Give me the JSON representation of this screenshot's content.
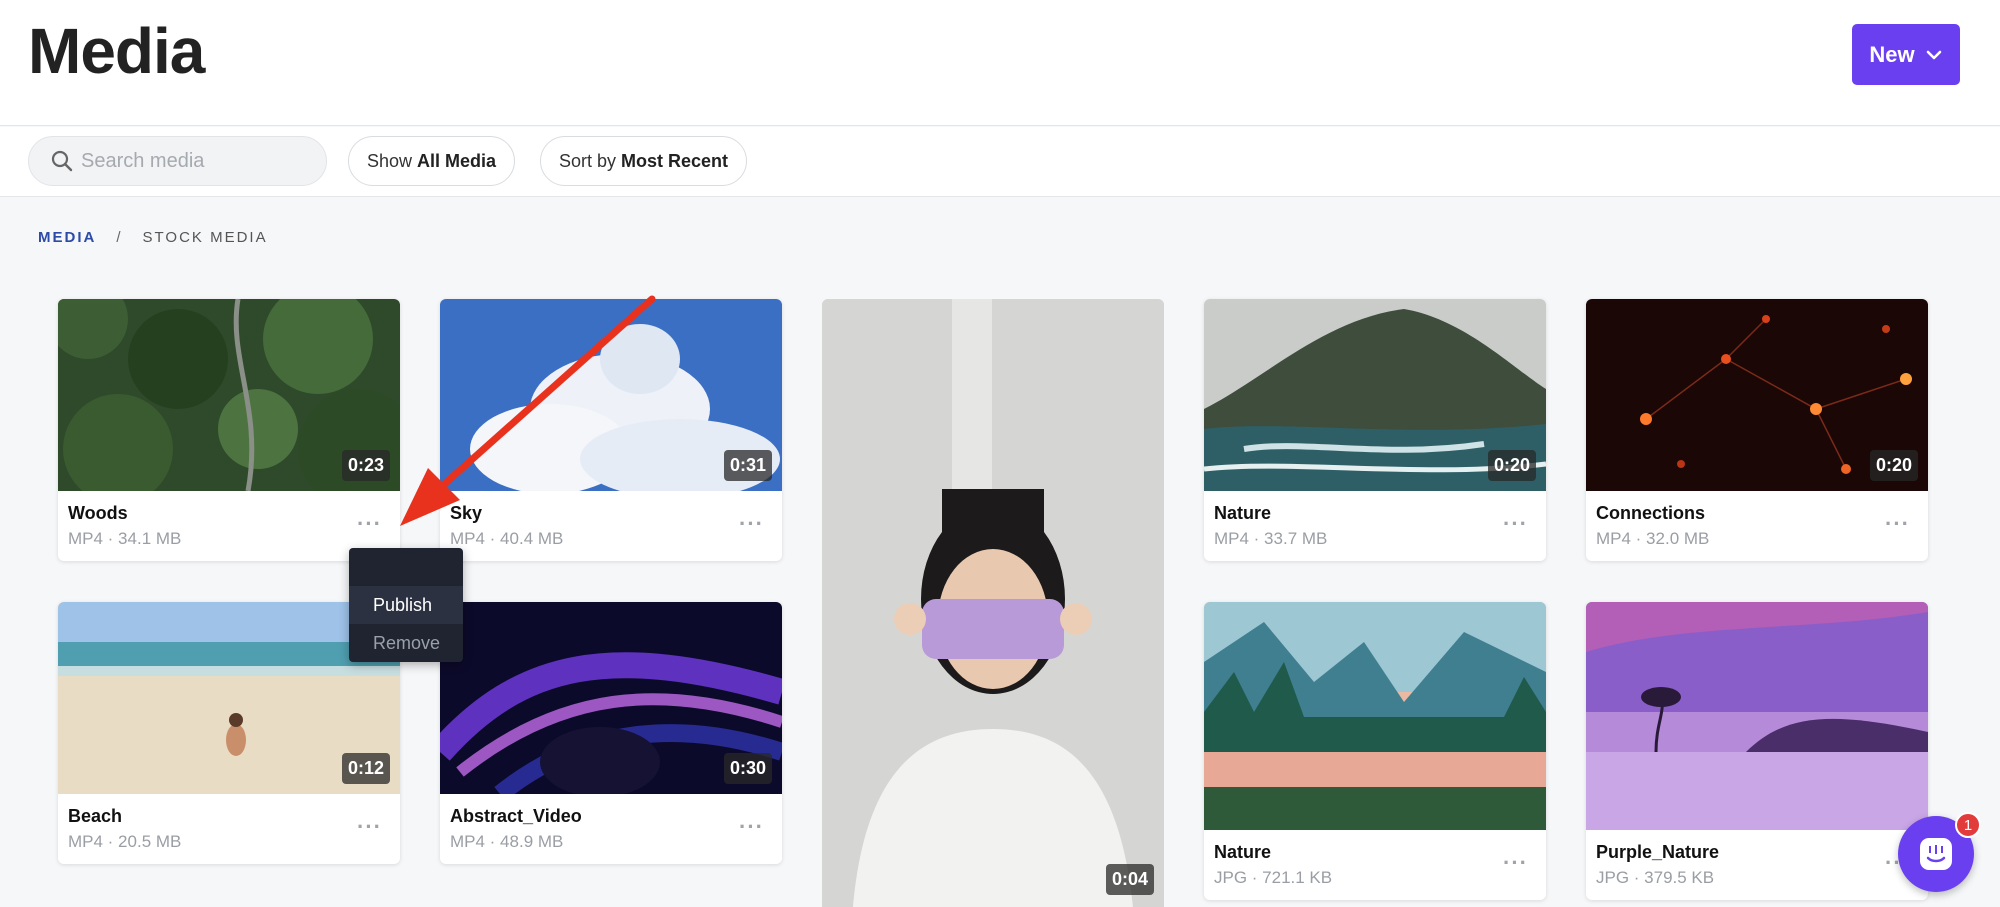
{
  "header": {
    "title": "Media",
    "new_label": "New"
  },
  "toolbar": {
    "search_placeholder": "Search media",
    "show_prefix": "Show",
    "show_value": "All Media",
    "sort_prefix": "Sort by",
    "sort_value": "Most Recent"
  },
  "breadcrumb": {
    "root": "MEDIA",
    "separator": "/",
    "current": "STOCK MEDIA"
  },
  "cards": [
    {
      "name": "Woods",
      "info": "MP4 · 34.1 MB",
      "duration": "0:23"
    },
    {
      "name": "Sky",
      "info": "MP4 · 40.4 MB",
      "duration": "0:31"
    },
    {
      "name": "Nature",
      "info": "MP4 · 33.7 MB",
      "duration": "0:20"
    },
    {
      "name": "Connections",
      "info": "MP4 · 32.0 MB",
      "duration": "0:20"
    },
    {
      "name": "Beach",
      "info": "MP4 · 20.5 MB",
      "duration": "0:12"
    },
    {
      "name": "Abstract_Video",
      "info": "MP4 · 48.9 MB",
      "duration": "0:30"
    },
    {
      "name": "Nature",
      "info": "JPG · 721.1 KB"
    },
    {
      "name": "Purple_Nature",
      "info": "JPG · 379.5 KB"
    }
  ],
  "tall_card": {
    "duration": "0:04"
  },
  "context_menu": {
    "publish": "Publish",
    "remove": "Remove"
  },
  "chat": {
    "badge_count": "1"
  },
  "colors": {
    "accent": "#6a3ff0",
    "badge": "#e23b3b",
    "arrow": "#e8321e"
  }
}
